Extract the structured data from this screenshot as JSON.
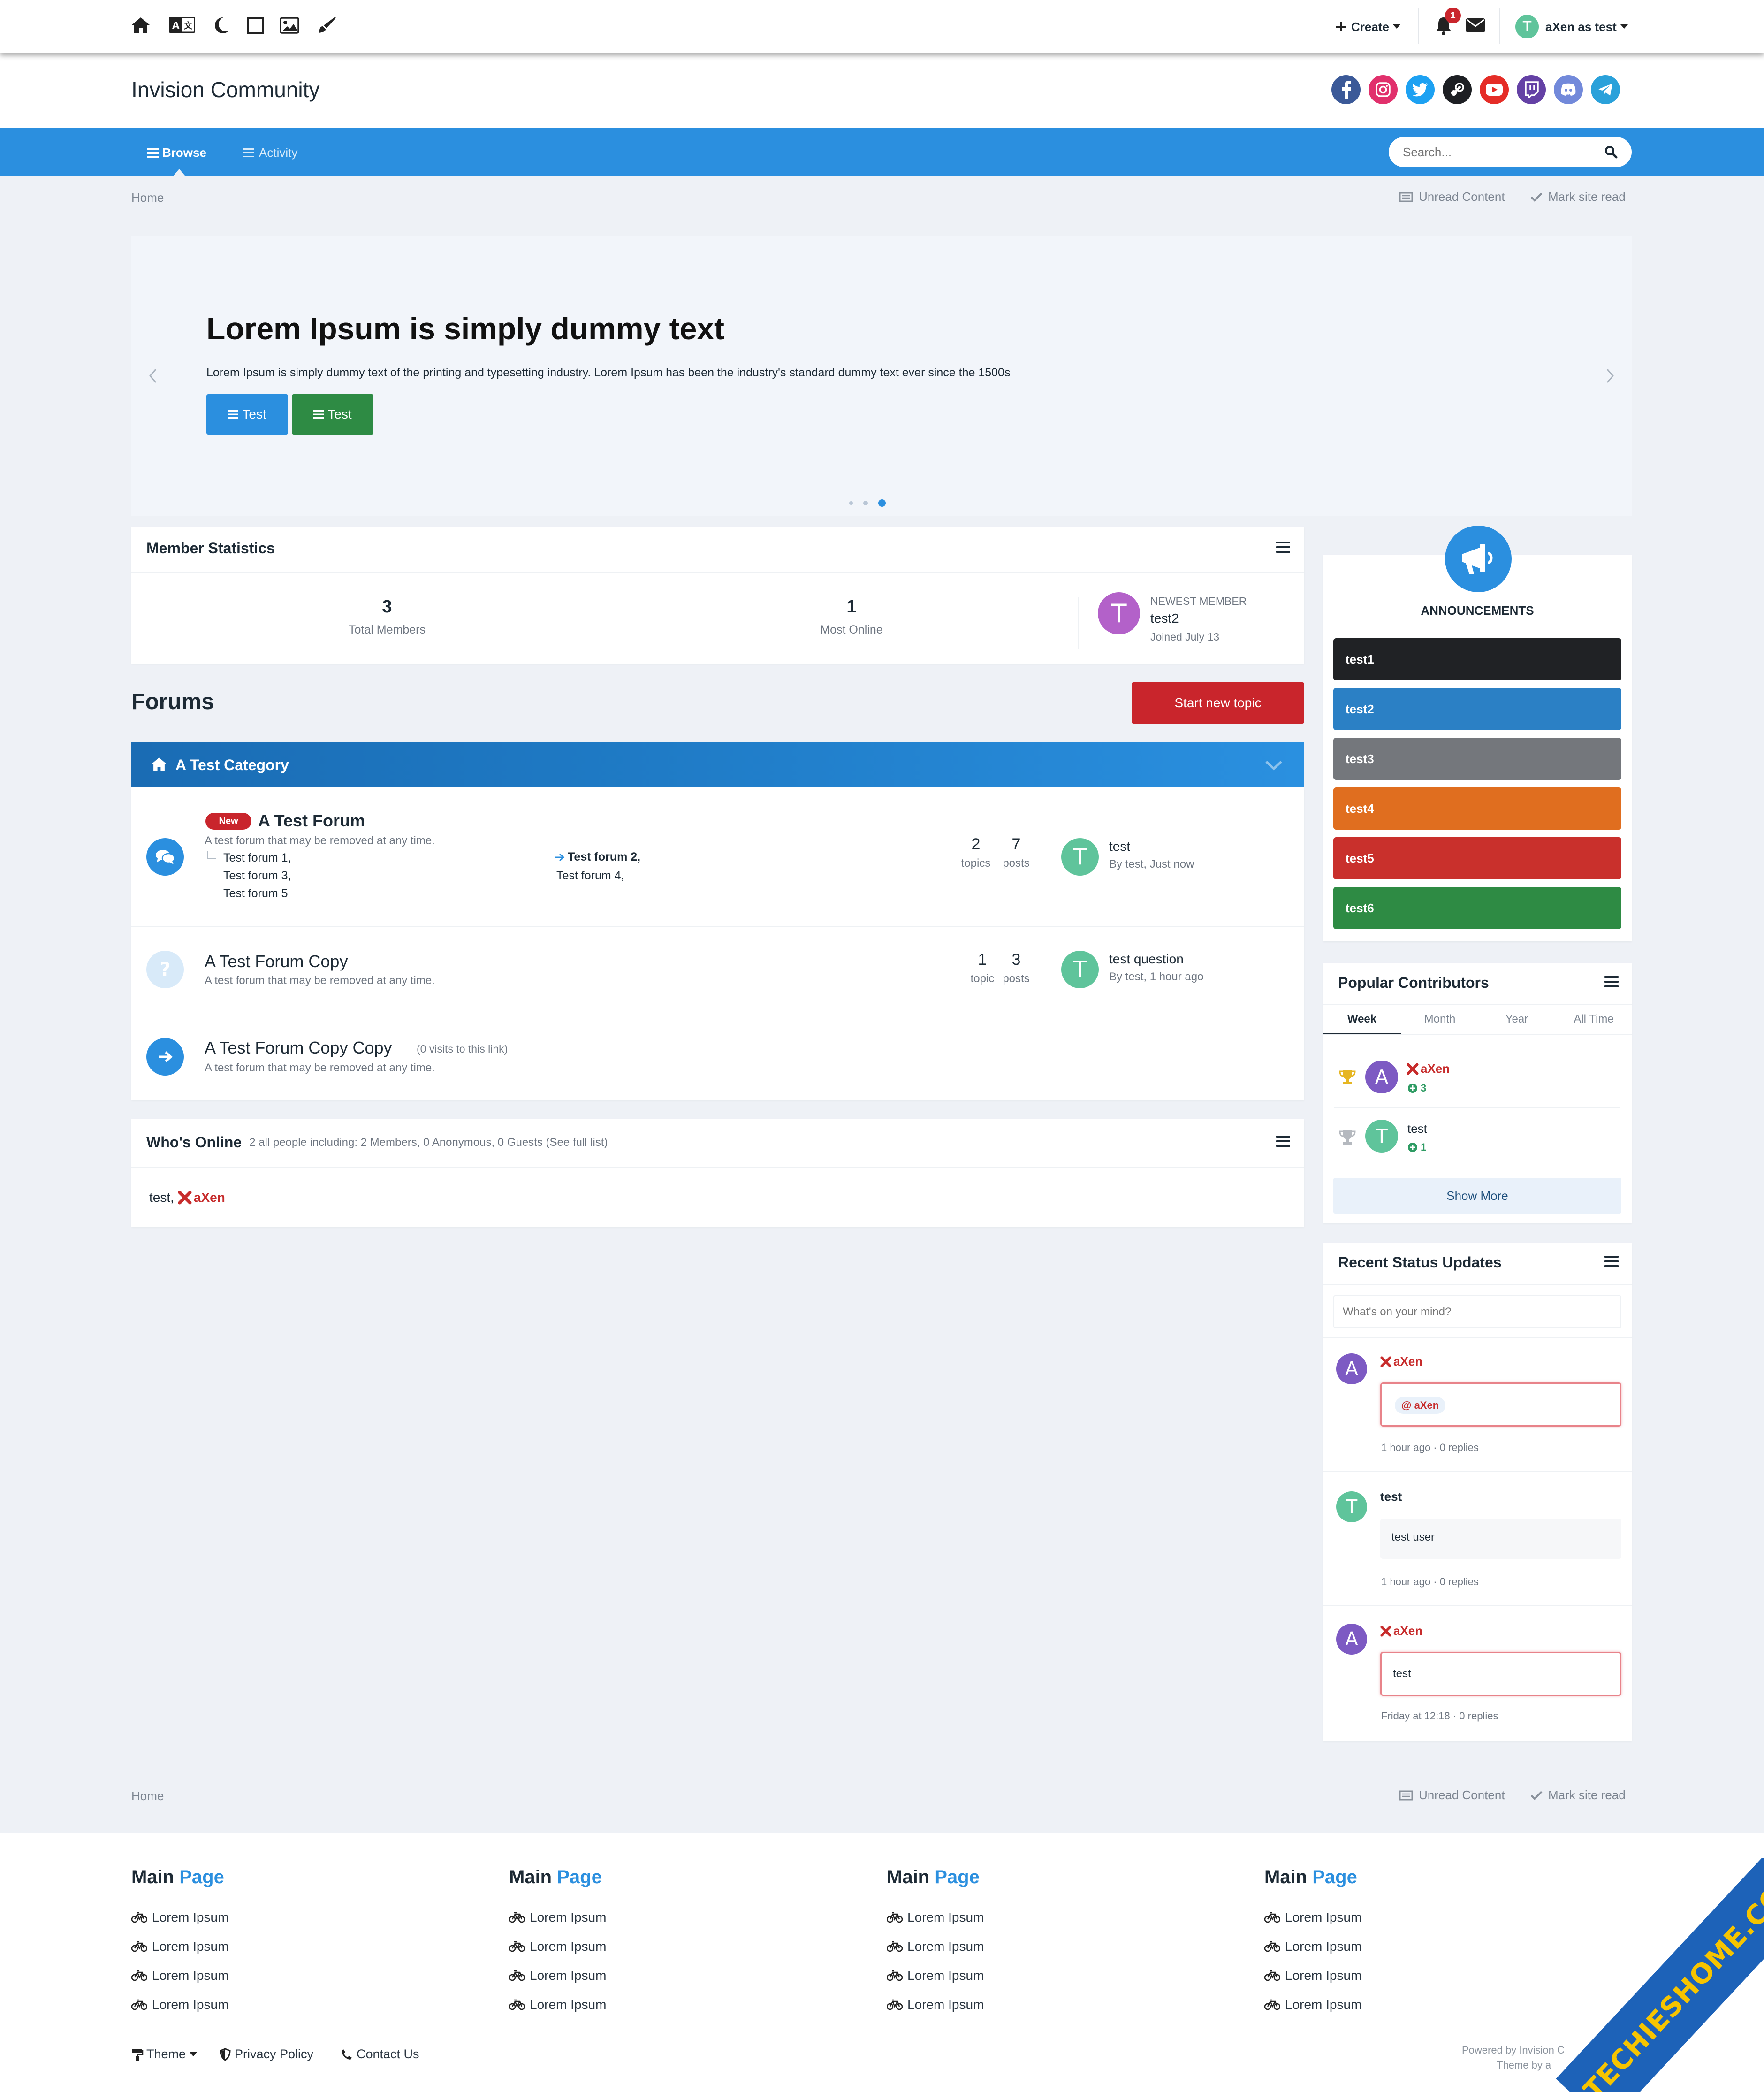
{
  "topbar": {
    "create_label": "Create",
    "notifications_count": "1",
    "user_label": "aXen as test",
    "user_initial": "T"
  },
  "brand": {
    "site_title": "Invision Community"
  },
  "nav": {
    "browse": "Browse",
    "activity": "Activity",
    "search_placeholder": "Search..."
  },
  "breadcrumb": {
    "home": "Home",
    "unread": "Unread Content",
    "mark_read": "Mark site read"
  },
  "hero": {
    "title": "Lorem Ipsum is simply dummy text",
    "text": "Lorem Ipsum is simply dummy text of the printing and typesetting industry. Lorem Ipsum has been the industry's standard dummy text ever since the 1500s",
    "button1": "Test",
    "button2": "Test",
    "active_slide": 3,
    "slide_count": 3
  },
  "member_stats": {
    "title": "Member Statistics",
    "total_members_value": "3",
    "total_members_label": "Total Members",
    "most_online_value": "1",
    "most_online_label": "Most Online",
    "newest_label": "NEWEST MEMBER",
    "newest_name": "test2",
    "newest_initial": "T",
    "newest_joined": "Joined July 13"
  },
  "forums": {
    "title": "Forums",
    "start_topic": "Start new topic",
    "category": "A Test Category",
    "list": [
      {
        "badge": "New",
        "name": "A Test Forum",
        "desc": "A test forum that may be removed at any time.",
        "sub_left": [
          "Test forum 1,",
          "Test forum 3,",
          "Test forum 5"
        ],
        "sub_right": [
          "Test forum 2,",
          "Test forum 4,"
        ],
        "topics": "2",
        "topics_label": "topics",
        "posts": "7",
        "posts_label": "posts",
        "last_title": "test",
        "last_meta": "By test, Just now",
        "last_initial": "T"
      },
      {
        "name": "A Test Forum Copy",
        "desc": "A test forum that may be removed at any time.",
        "topics": "1",
        "topics_label": "topic",
        "posts": "3",
        "posts_label": "posts",
        "last_title": "test question",
        "last_meta": "By test, 1 hour ago",
        "last_initial": "T"
      },
      {
        "name": "A Test Forum Copy Copy",
        "visits": "(0 visits to this link)",
        "desc": "A test forum that may be removed at any time."
      }
    ]
  },
  "whos_online": {
    "title": "Who's Online",
    "summary": "2 all people including: 2 Members, 0 Anonymous, 0 Guests (See full list)",
    "user1": "test,",
    "user2": "aXen"
  },
  "announcements": {
    "title": "ANNOUNCEMENTS",
    "items": [
      {
        "label": "test1",
        "color": "#202225"
      },
      {
        "label": "test2",
        "color": "#2b80c5"
      },
      {
        "label": "test3",
        "color": "#74777c"
      },
      {
        "label": "test4",
        "color": "#e06e1f"
      },
      {
        "label": "test5",
        "color": "#c9302c"
      },
      {
        "label": "test6",
        "color": "#2e8b44"
      }
    ]
  },
  "contributors": {
    "title": "Popular Contributors",
    "tabs": [
      "Week",
      "Month",
      "Year",
      "All Time"
    ],
    "active_tab": "Week",
    "list": [
      {
        "initial": "A",
        "name": "aXen",
        "score": "3"
      },
      {
        "initial": "T",
        "name": "test",
        "score": "1"
      }
    ],
    "show_more": "Show More"
  },
  "status_updates": {
    "title": "Recent Status Updates",
    "placeholder": "What's on your mind?",
    "items": [
      {
        "initial": "A",
        "name": "aXen",
        "content": "@ aXen",
        "meta": "1 hour ago · 0 replies"
      },
      {
        "initial": "T",
        "name": "test",
        "content": "test user",
        "meta": "1 hour ago · 0 replies"
      },
      {
        "initial": "A",
        "name": "aXen",
        "content": "test",
        "meta": "Friday at 12:18 · 0 replies"
      }
    ]
  },
  "footer": {
    "col_title_a": "Main",
    "col_title_b": "Page",
    "link": "Lorem Ipsum",
    "theme": "Theme",
    "privacy": "Privacy Policy",
    "contact": "Contact Us",
    "powered": "Powered by Invision C",
    "theme_by": "Theme by a"
  },
  "watermark": "TECHIESHOME.COM",
  "colors": {
    "accent": "#2b8fdf",
    "danger": "#d42a2a",
    "mention": "#c72c2c",
    "green_avatar": "#5fc49b",
    "purple_avatar": "#7d5ac3",
    "pink_avatar": "#b361c9"
  }
}
